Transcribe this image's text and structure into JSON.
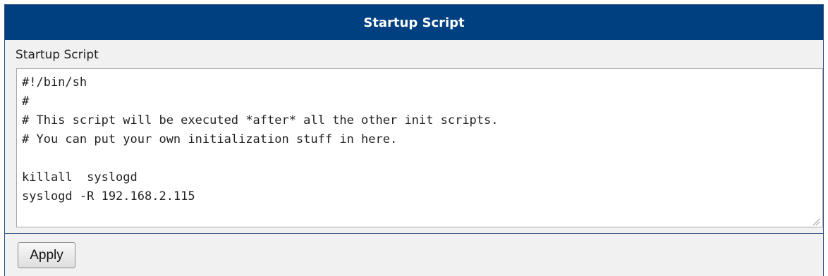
{
  "panel": {
    "title": "Startup Script",
    "colors": {
      "header_bg": "#004080",
      "header_text": "#ffffff",
      "panel_bg": "#f1f1f1"
    }
  },
  "script_field": {
    "label": "Startup Script",
    "value": "#!/bin/sh\n#\n# This script will be executed *after* all the other init scripts.\n# You can put your own initialization stuff in here.\n\nkillall  syslogd\nsyslogd -R 192.168.2.115",
    "resize_icon": "resize-grip-icon"
  },
  "actions": {
    "apply_label": "Apply"
  }
}
